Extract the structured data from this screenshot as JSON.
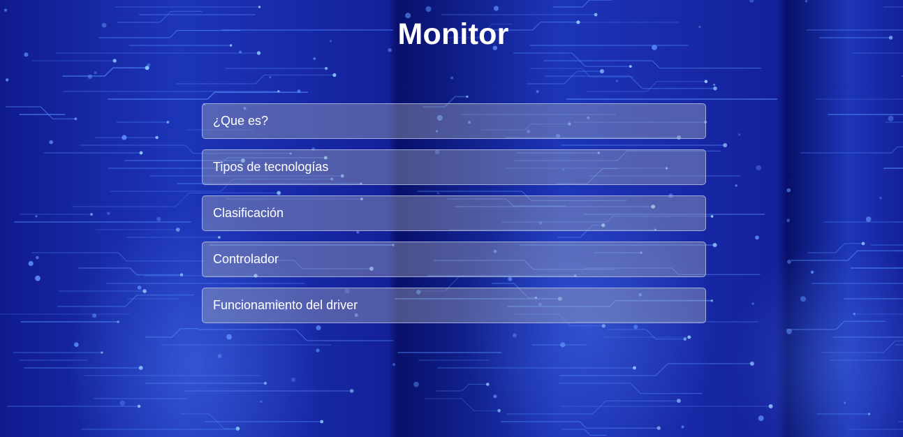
{
  "page": {
    "title": "Monitor"
  },
  "menu": {
    "items": [
      {
        "label": "¿Que es?"
      },
      {
        "label": "Tipos de tecnologías"
      },
      {
        "label": "Clasificación"
      },
      {
        "label": "Controlador"
      },
      {
        "label": "Funcionamiento del driver"
      }
    ]
  },
  "colors": {
    "background": "#1d35b8",
    "circuit_line": "#4f86f5",
    "circuit_node": "#8fc8ff",
    "button_bg": "#a5aab9",
    "text": "#ffffff"
  },
  "background_image": "circuit-board-pattern"
}
